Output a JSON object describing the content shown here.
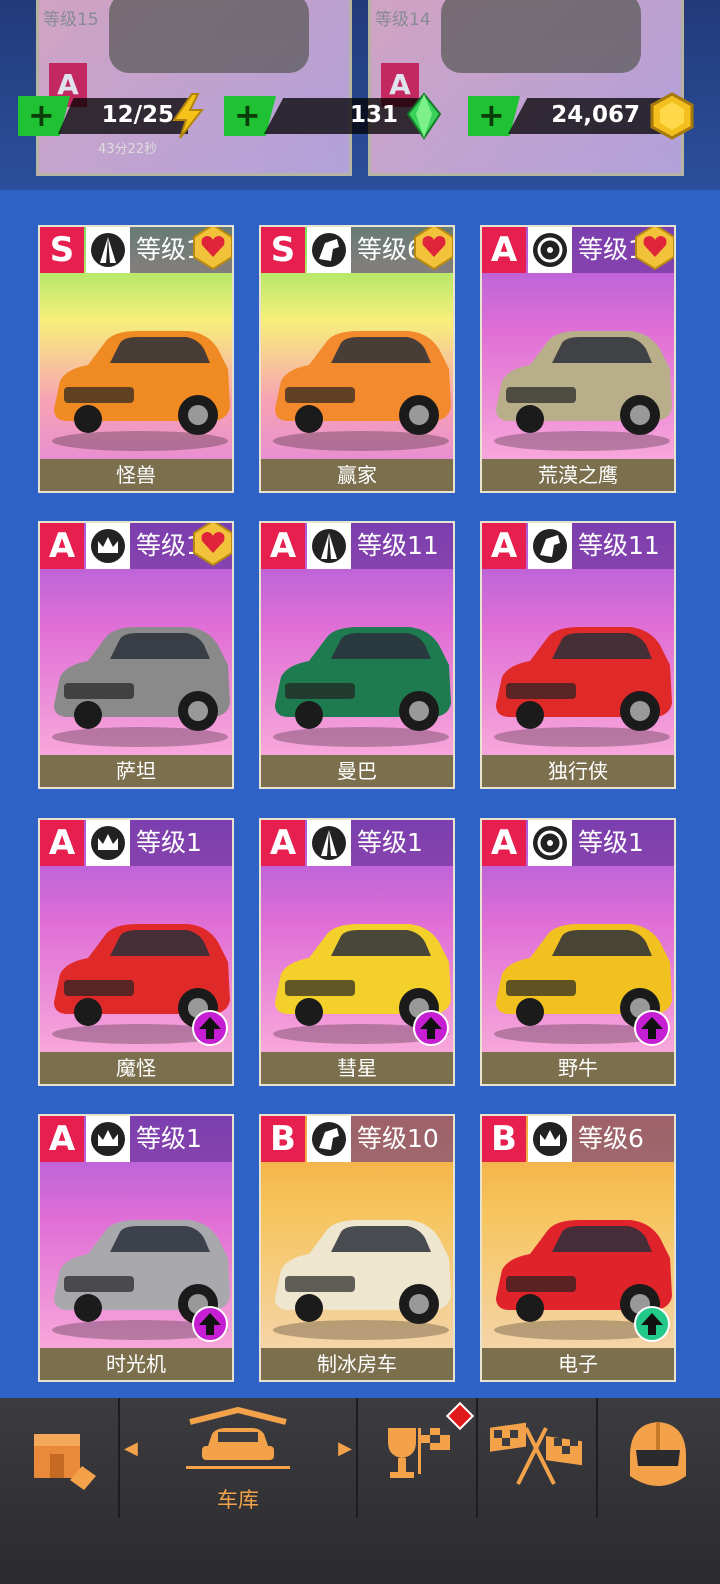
{
  "top_strip": {
    "ghost_cards": [
      {
        "level": "等级15",
        "rank": "A"
      },
      {
        "level": "等级14",
        "rank": "A"
      }
    ]
  },
  "resources": {
    "energy": {
      "value": "12/25",
      "timer": "43分22秒"
    },
    "gems": {
      "value": "131"
    },
    "coins": {
      "value": "24,067"
    }
  },
  "cars": [
    {
      "rank": "S",
      "tier_icon": "road-icon",
      "level": "等级1",
      "name": "怪兽",
      "bg": "rainbow",
      "favorite": true,
      "upgrade": null,
      "color": "#f08a22"
    },
    {
      "rank": "S",
      "tier_icon": "horse-icon",
      "level": "等级6",
      "name": "赢家",
      "bg": "rainbow",
      "favorite": true,
      "upgrade": null,
      "color": "#f38a2e"
    },
    {
      "rank": "A",
      "tier_icon": "wheel-icon",
      "level": "等级1",
      "name": "荒漠之鹰",
      "bg": "purple",
      "favorite": true,
      "upgrade": null,
      "color": "#b9ae8a"
    },
    {
      "rank": "A",
      "tier_icon": "crown-icon",
      "level": "等级1",
      "name": "萨坦",
      "bg": "purple",
      "favorite": true,
      "upgrade": null,
      "color": "#8a8a8a"
    },
    {
      "rank": "A",
      "tier_icon": "road-icon",
      "level": "等级11",
      "name": "曼巴",
      "bg": "purple",
      "favorite": false,
      "upgrade": null,
      "color": "#1e7a4f"
    },
    {
      "rank": "A",
      "tier_icon": "horse-icon",
      "level": "等级11",
      "name": "独行侠",
      "bg": "purple",
      "favorite": false,
      "upgrade": null,
      "color": "#e02a2a"
    },
    {
      "rank": "A",
      "tier_icon": "crown-icon",
      "level": "等级1",
      "name": "魔怪",
      "bg": "purple",
      "favorite": false,
      "upgrade": "purple",
      "color": "#e02a2a"
    },
    {
      "rank": "A",
      "tier_icon": "road-icon",
      "level": "等级1",
      "name": "彗星",
      "bg": "purple",
      "favorite": false,
      "upgrade": "purple",
      "color": "#f3d02a"
    },
    {
      "rank": "A",
      "tier_icon": "wheel-icon",
      "level": "等级1",
      "name": "野牛",
      "bg": "purple",
      "favorite": false,
      "upgrade": "purple",
      "color": "#f1c21f"
    },
    {
      "rank": "A",
      "tier_icon": "crown-icon",
      "level": "等级1",
      "name": "时光机",
      "bg": "purple",
      "favorite": false,
      "upgrade": "purple",
      "color": "#a9a9ad"
    },
    {
      "rank": "B",
      "tier_icon": "horse-icon",
      "level": "等级10",
      "name": "制冰房车",
      "bg": "orange",
      "favorite": false,
      "upgrade": null,
      "color": "#efe6cf"
    },
    {
      "rank": "B",
      "tier_icon": "crown-icon",
      "level": "等级6",
      "name": "电子",
      "bg": "orange",
      "favorite": false,
      "upgrade": "green",
      "color": "#e0222a"
    }
  ],
  "nav": {
    "tabs": [
      {
        "name": "shop-tab",
        "icon": "shop-icon"
      },
      {
        "name": "garage-tab",
        "icon": "garage-icon",
        "label": "车库",
        "active": true
      },
      {
        "name": "trophy-tab",
        "icon": "trophy-flag-icon",
        "notification": true
      },
      {
        "name": "race-tab",
        "icon": "checkered-flags-icon"
      },
      {
        "name": "profile-tab",
        "icon": "helmet-icon"
      }
    ]
  },
  "colors": {
    "background": "#2f62c6",
    "accent": "#f3a24a",
    "rank_badge": "#e61f4f",
    "plus": "#1fc233"
  }
}
